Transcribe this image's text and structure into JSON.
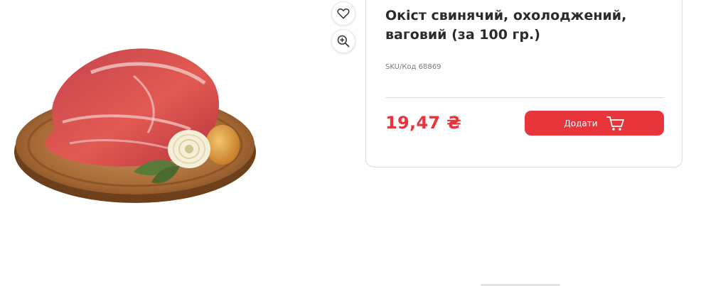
{
  "product": {
    "title": "Окіст свинячий, охолоджений, ваговий (за 100 гр.)",
    "sku": "SKU/Код 68869",
    "price": "19,47 ₴",
    "add_button_label": "Додати"
  },
  "icons": {
    "favorite": "heart-icon",
    "zoom": "zoom-in-icon",
    "cart": "cart-icon"
  },
  "colors": {
    "accent": "#e8343b",
    "text": "#2b2b2b",
    "muted": "#777777",
    "border": "#dedede"
  }
}
